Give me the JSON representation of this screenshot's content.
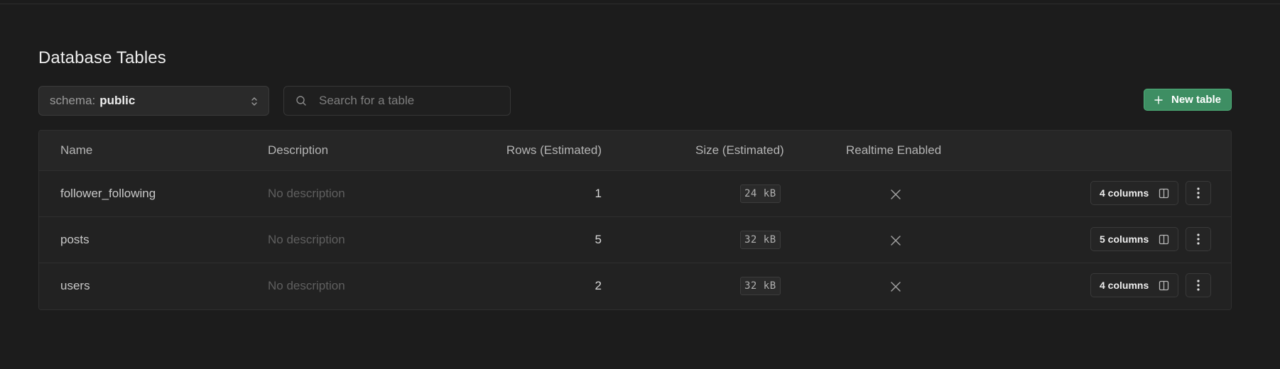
{
  "page": {
    "title": "Database Tables"
  },
  "toolbar": {
    "schema_prefix": "schema:",
    "schema_value": "public",
    "search_placeholder": "Search for a table",
    "new_table_label": "New table"
  },
  "table": {
    "headers": {
      "name": "Name",
      "description": "Description",
      "rows": "Rows (Estimated)",
      "size": "Size (Estimated)",
      "realtime": "Realtime Enabled"
    },
    "rows": [
      {
        "name": "follower_following",
        "description": "No description",
        "rows": "1",
        "size": "24 kB",
        "realtime": false,
        "columns": "4 columns"
      },
      {
        "name": "posts",
        "description": "No description",
        "rows": "5",
        "size": "32 kB",
        "realtime": false,
        "columns": "5 columns"
      },
      {
        "name": "users",
        "description": "No description",
        "rows": "2",
        "size": "32 kB",
        "realtime": false,
        "columns": "4 columns"
      }
    ]
  },
  "colors": {
    "background": "#1c1c1c",
    "accent_green": "#3e8e63",
    "border": "#2f2f2f"
  }
}
